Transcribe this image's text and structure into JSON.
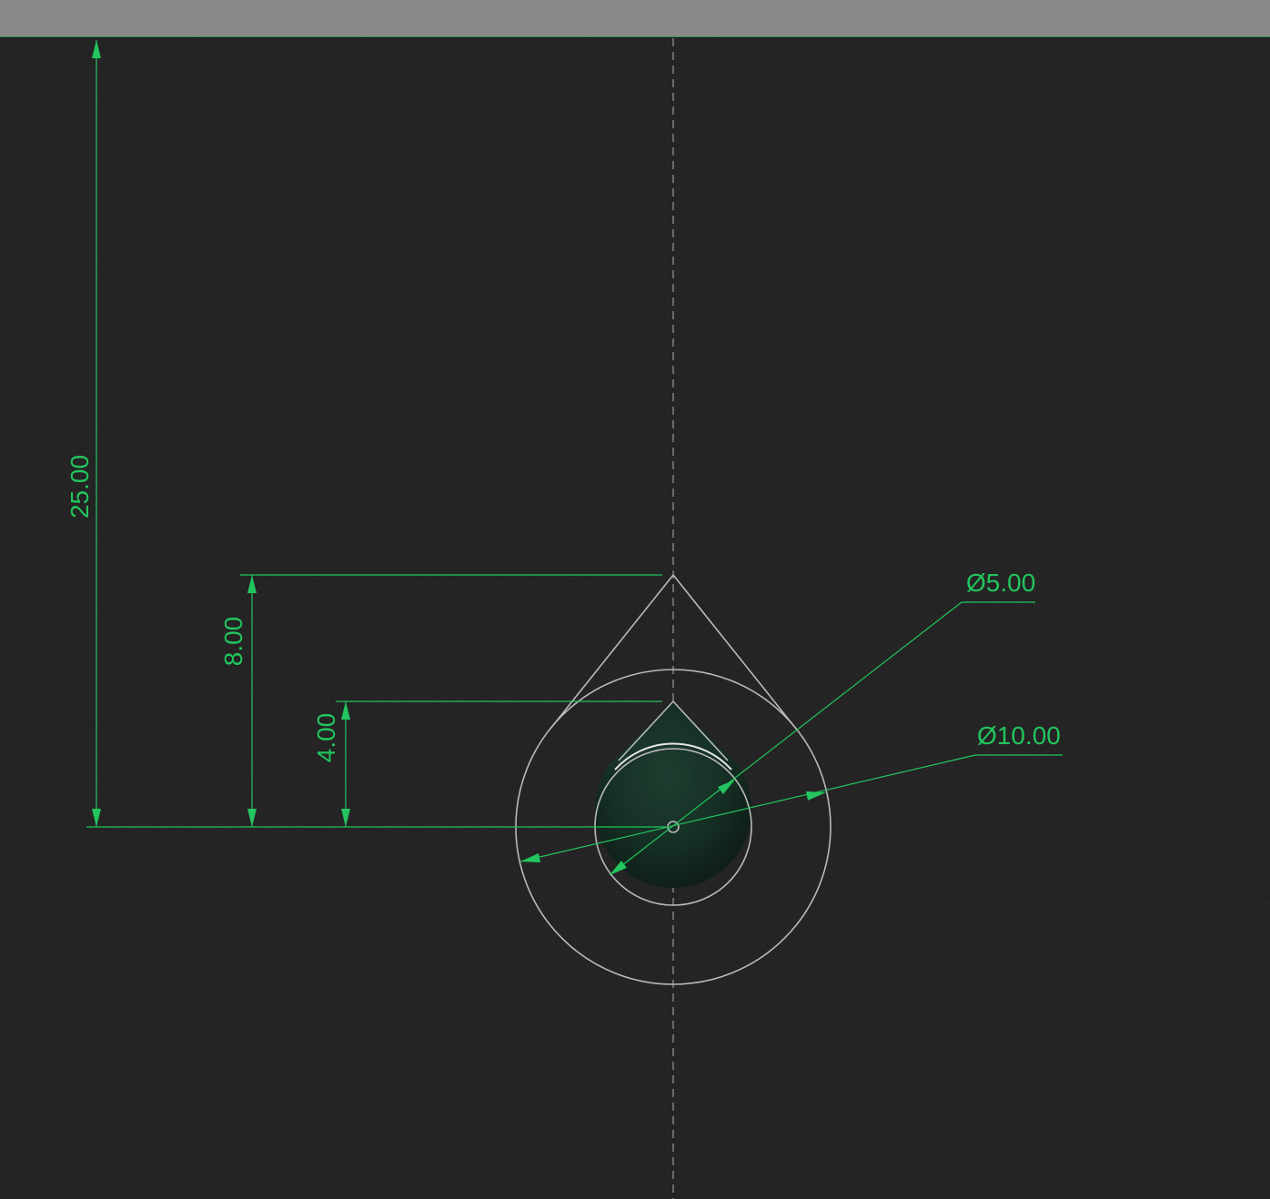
{
  "dimensions": {
    "overall_height": "25.00",
    "outer_height": "8.00",
    "inner_height": "4.00",
    "small_diameter": "Ø5.00",
    "large_diameter": "Ø10.00"
  },
  "colors": {
    "dimension": "#22c55e",
    "geometry": "#b9b9b9",
    "background": "#1b1b1b",
    "toolbar": "#898989"
  }
}
